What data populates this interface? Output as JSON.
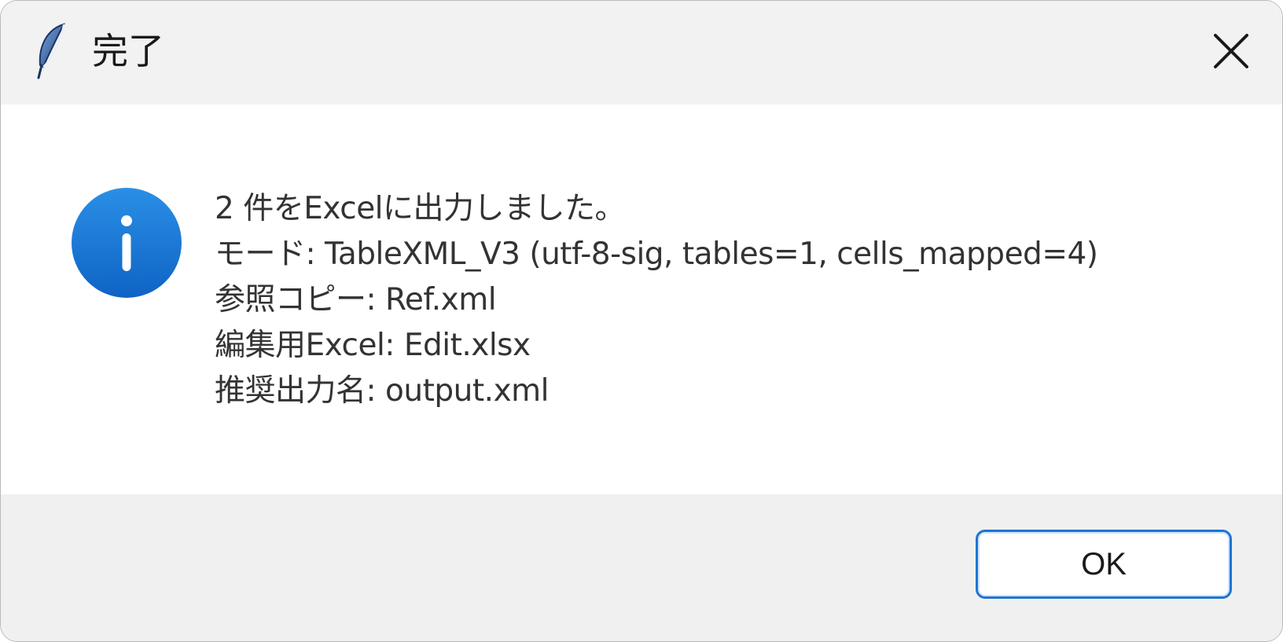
{
  "window": {
    "title": "完了",
    "app_icon": "feather-icon",
    "close_icon": "close-icon"
  },
  "message": {
    "icon": "info-icon",
    "lines": [
      "2 件をExcelに出力しました。",
      "モード: TableXML_V3 (utf-8-sig, tables=1, cells_mapped=4)",
      "参照コピー: Ref.xml",
      "編集用Excel: Edit.xlsx",
      "推奨出力名: output.xml"
    ]
  },
  "footer": {
    "ok_label": "OK"
  },
  "colors": {
    "titlebar_bg": "#f2f2f2",
    "footer_bg": "#f0f0f0",
    "accent": "#1f74d3",
    "info_icon": "#1a7fd6"
  }
}
